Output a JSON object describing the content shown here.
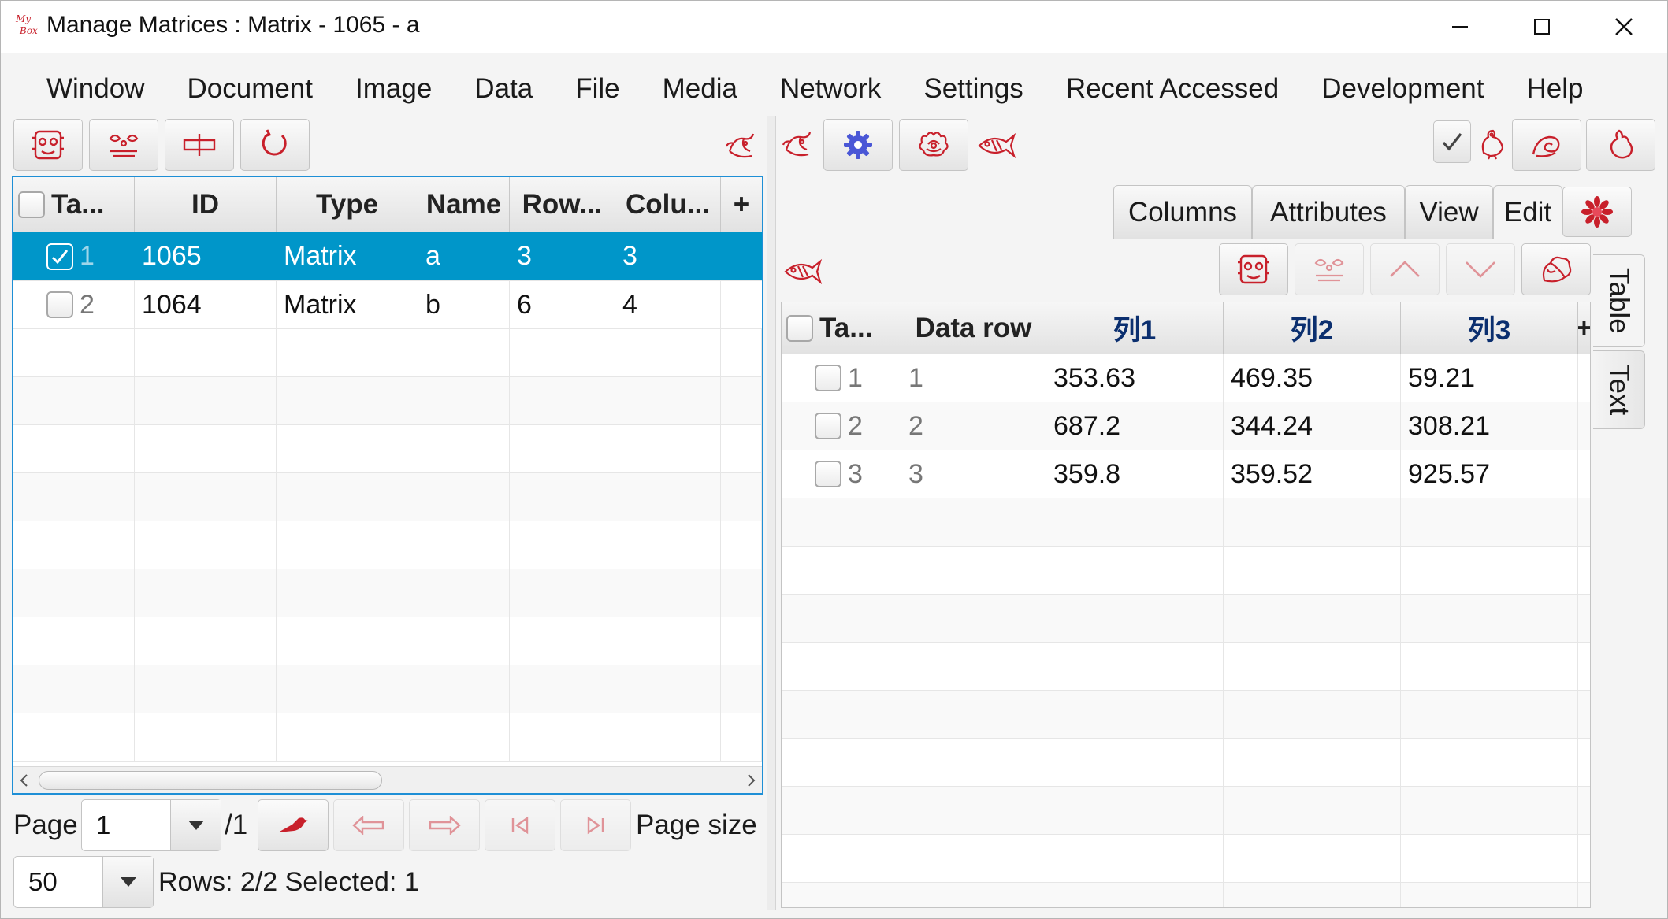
{
  "window": {
    "title": "Manage Matrices : Matrix - 1065 - a",
    "logo_text_top": "My",
    "logo_text_bottom": "Box",
    "controls": [
      "minimize-icon",
      "maximize-icon",
      "close-icon"
    ]
  },
  "menu": [
    "Window",
    "Document",
    "Image",
    "Data",
    "File",
    "Media",
    "Network",
    "Settings",
    "Recent Accessed",
    "Development",
    "Help"
  ],
  "colors": {
    "icon_red": "#c8202b",
    "selection_blue": "#0096c9",
    "focus_border": "#1e8fd6",
    "gear_blue": "#4a57d6",
    "header_blue_text": "#0b2f6f"
  },
  "left": {
    "toolbar_icons": [
      "mask-icon",
      "spiral-pattern-icon",
      "clear-icon",
      "refresh-icon",
      "phoenix-menu-icon"
    ],
    "table": {
      "columns": [
        "Ta...",
        "ID",
        "Type",
        "Name",
        "Row...",
        "Colu..."
      ],
      "add_column_glyph": "+",
      "rows": [
        {
          "index": "1",
          "checked": true,
          "id": "1065",
          "type": "Matrix",
          "name": "a",
          "rows": "3",
          "columns": "3",
          "selected": true
        },
        {
          "index": "2",
          "checked": false,
          "id": "1064",
          "type": "Matrix",
          "name": "b",
          "rows": "6",
          "columns": "4",
          "selected": false
        }
      ]
    },
    "pagination": {
      "page_label": "Page",
      "page_value": "1",
      "page_total": "/1",
      "page_size_label": "Page size",
      "page_size_value": "50",
      "status": "Rows: 2/2 Selected: 1",
      "nav_icons": [
        "go-bird-icon",
        "previous-page-icon",
        "next-page-icon",
        "first-page-icon",
        "last-page-icon"
      ]
    }
  },
  "right": {
    "toolbar_icons": [
      "phoenix-icon",
      "gear-icon",
      "peony-icon",
      "fish-icon",
      "rooster-icon",
      "swirl-icon",
      "gourd-icon"
    ],
    "tabs": [
      "Columns",
      "Attributes",
      "View",
      "Edit"
    ],
    "active_tab": "Edit",
    "side_tabs": [
      "Table",
      "Text"
    ],
    "active_side_tab": "Table",
    "data_toolbar_icons": [
      "fish-menu-icon",
      "mask-add-icon",
      "delete-rows-icon",
      "move-up-icon",
      "move-down-icon",
      "flower-menu-icon"
    ],
    "table": {
      "columns": [
        "Ta...",
        "Data row",
        "列1",
        "列2",
        "列3"
      ],
      "add_column_glyph": "+",
      "rows": [
        {
          "index": "1",
          "data_row": "1",
          "c1": "353.63",
          "c2": "469.35",
          "c3": "59.21"
        },
        {
          "index": "2",
          "data_row": "2",
          "c1": "687.2",
          "c2": "344.24",
          "c3": "308.21"
        },
        {
          "index": "3",
          "data_row": "3",
          "c1": "359.8",
          "c2": "359.52",
          "c3": "925.57"
        }
      ]
    }
  }
}
